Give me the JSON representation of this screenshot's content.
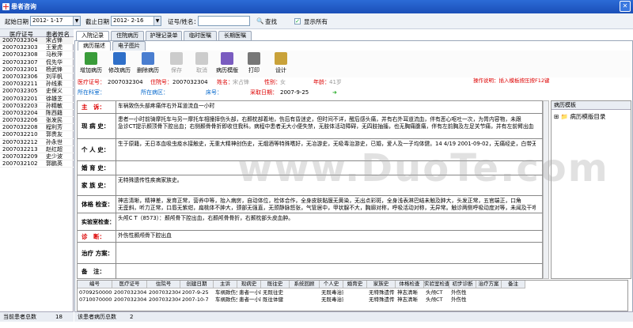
{
  "window": {
    "title": "患者咨询"
  },
  "search": {
    "start_label": "起始日期",
    "start_date": "2012- 1-17",
    "end_label": "截止日期",
    "end_date": "2012- 2-16",
    "id_label": "证号/姓名：",
    "find_label": "查找",
    "show_all_label": "显示所有"
  },
  "patients": {
    "columns": [
      "医疗证号",
      "患者姓名"
    ],
    "rows": [
      [
        "2007032304",
        "宋占锋"
      ],
      [
        "2007032303",
        "王爱虎"
      ],
      [
        "2007032308",
        "马秋萍"
      ],
      [
        "2007032307",
        "侃先华"
      ],
      [
        "2007032301",
        "杨武锋"
      ],
      [
        "2007032306",
        "刘平帆"
      ],
      [
        "2007032211",
        "孙线素"
      ],
      [
        "2007032305",
        "史保义"
      ],
      [
        "2007032201",
        "徐雄芝"
      ],
      [
        "2007032203",
        "孙精敏"
      ],
      [
        "2007032204",
        "陈西籍"
      ],
      [
        "2007032206",
        "张发民"
      ],
      [
        "2007032208",
        "程利芳"
      ],
      [
        "2007032210",
        "郭贵友"
      ],
      [
        "2007032212",
        "孙永世"
      ],
      [
        "2007032213",
        "赵红超"
      ],
      [
        "2007032209",
        "史少波"
      ],
      [
        "2007032102",
        "郭鹏英"
      ]
    ],
    "footer_label": "当前患者总数",
    "footer_count": "18"
  },
  "tabs": [
    "入院记录",
    "住院病历",
    "护理记录单",
    "临时医嘱",
    "长期医嘱"
  ],
  "subtabs": [
    "病历描述",
    "电子图片"
  ],
  "toolbar": [
    "增加病历",
    "修改病历",
    "删除病历",
    "保存",
    "取消",
    "病历模版",
    "打印",
    "设计"
  ],
  "info": {
    "id_label": "医疗证号：",
    "id_value": "2007032304",
    "inp_label": "住院号：",
    "inp_value": "2007032304",
    "name_label": "姓名：",
    "name_value": "宋占锋",
    "sex_label": "性别：",
    "sex_value": "女",
    "age_label": "年龄：",
    "age_value": "41岁",
    "dept_label": "所在科室：",
    "ward_label": "所在病区：",
    "bed_label": "床号：",
    "date_label": "采取日期：",
    "date_value": "2007-9-25",
    "hint": "操作说明：插入模板按压按F12键"
  },
  "form": {
    "complaint_label": "主　诉：",
    "complaint": "车祸致伤头部疼痛伴右外耳道流血一小时",
    "present_label": "现 病 史：",
    "present1": "患者一小时前骑摩托车与另一摩托车相撞摔伤头部，右颞枕部着地，伤后有昏迷史，但时间不详，醒后感头痛，并有右外耳道流血，伴有恶心呕吐一次，为胃内容物，未跟",
    "present2": "急诊CT提示颞顶骨下腔出血；右侧颞骨骨折即收住我科。病程中患者无大小便失禁，无肢体活动障碍，无四肢抽搐，也无胸痛腹痛，伴有左前胸及左足关节痛，并有左前臂出血",
    "personal_label": "个 人 史：",
    "personal": "生于原籍，无日本血吸虫疫水接触史，无重大精神创伤史，无烟酒等特殊嗜好，无冶游史，无吸毒治游史，已婚，爱人及一子均体健。14 4/19 2001-09-02，无痛经史，白带无异常。",
    "obstetric_label": "婚 育 史：",
    "family_label": "家 族 史：",
    "family": "无特殊遗传性疾病家族史。",
    "exam_label": "体格 检查：",
    "exam1": "神志清晰，精神差，发育正常，营养中等，抬入病房，自动体位，检体合作，全身皮肤黏膜无黄染，无出点彩斑，全身浅表淋巴结未触及肿大，头发正常，五官端正，口角",
    "exam2": "无歪斜，听力正常，口唇无紫绀，扁桃体不肿大，颈部无强直，无颈静脉怒张，气管居中，甲状腺不大，胸廓对称，呼吸活动对称，无异常。触诊两侧呼吸动度对等，未闻及干啰音",
    "lab_label": "实验室检查：",
    "lab": "头颅C T（8573）：颞颅骨下腔出血，右颞颅骨骨折，右颞枕部头皮血肿。",
    "diagnosis_label": "诊　断：",
    "diagnosis": "外伤性颞颅骨下腔出血",
    "plan_label": "治疗 方案：",
    "remark_label": "备　注："
  },
  "template_panel": {
    "header": "病历模板",
    "root": "病历模版目录"
  },
  "records": {
    "columns": [
      "编号",
      "医疗证号",
      "住院号",
      "创建日期",
      "主诉",
      "现病史",
      "既往史",
      "系统回顾",
      "个人史",
      "婚育史",
      "家族史",
      "体格检查",
      "实验室检查",
      "初步诊断",
      "治疗方案",
      "备注"
    ],
    "rows": [
      [
        "0709250000",
        "2007032304",
        "2007032304",
        "2007-9-25",
        "车祸致伤头部",
        "患者一小时前",
        "无既往史",
        "",
        "无既毒治家",
        "",
        "无特殊遗传",
        "神志清晰",
        "头颅CT",
        "外伤性",
        "",
        ""
      ],
      [
        "0710070000",
        "2007032304",
        "2007032304",
        "2007-10-7",
        "车祸致伤头",
        "患者一小时前",
        "既往体健",
        "",
        "无既毒治家",
        "",
        "无特殊遗传",
        "神志清晰",
        "头颅CT",
        "外伤性",
        "",
        ""
      ]
    ],
    "footer_label": "该患者病历总数",
    "footer_count": "2"
  },
  "watermark": "www.DuoTe.com",
  "colors": {
    "title_bg": "#1a4fb8",
    "label_red": "#d00",
    "selected_row": "#f3f3f3"
  }
}
